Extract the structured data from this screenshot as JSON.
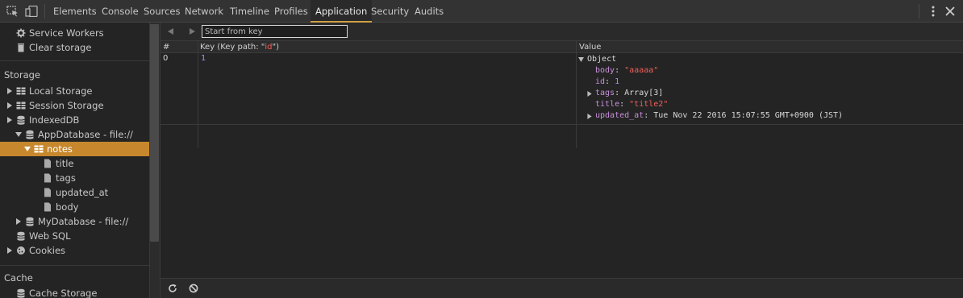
{
  "toolbar": {
    "tabs": [
      {
        "label": "Elements"
      },
      {
        "label": "Console"
      },
      {
        "label": "Sources"
      },
      {
        "label": "Network"
      },
      {
        "label": "Timeline"
      },
      {
        "label": "Profiles"
      },
      {
        "label": "Application",
        "active": true
      },
      {
        "label": "Security"
      },
      {
        "label": "Audits"
      }
    ],
    "icons": [
      "inspect-element-icon",
      "device-mode-icon",
      "more-options-icon",
      "close-icon"
    ]
  },
  "sidebar": {
    "application_items": [
      {
        "label": "Service Workers",
        "icon": "gear-icon"
      },
      {
        "label": "Clear storage",
        "icon": "trash-icon"
      }
    ],
    "storage_header": "Storage",
    "storage_items": [
      {
        "label": "Local Storage",
        "icon": "grid-icon"
      },
      {
        "label": "Session Storage",
        "icon": "grid-icon"
      },
      {
        "label": "IndexedDB",
        "icon": "database-icon"
      },
      {
        "label": "AppDatabase - file://",
        "icon": "database-icon"
      },
      {
        "label": "notes",
        "icon": "grid-icon",
        "selected": true
      },
      {
        "label": "title",
        "icon": "file-icon"
      },
      {
        "label": "tags",
        "icon": "file-icon"
      },
      {
        "label": "updated_at",
        "icon": "file-icon"
      },
      {
        "label": "body",
        "icon": "file-icon"
      },
      {
        "label": "MyDatabase - file://",
        "icon": "database-icon"
      },
      {
        "label": "Web SQL",
        "icon": "database-icon"
      },
      {
        "label": "Cookies",
        "icon": "cookie-icon"
      }
    ],
    "cache_header": "Cache",
    "cache_items": [
      {
        "label": "Cache Storage",
        "icon": "database-icon"
      }
    ]
  },
  "main": {
    "start_key_placeholder": "Start from key",
    "columns": {
      "index": "#",
      "key": "Key (Key path: \"",
      "key_path": "id",
      "key_suffix": "\")",
      "value": "Value"
    },
    "rows": [
      {
        "index": "0",
        "key": "1",
        "value": {
          "root": "Object",
          "body_prop": "body",
          "body_val": "\"aaaaa\"",
          "id_prop": "id",
          "id_val": "1",
          "tags_prop": "tags",
          "tags_val": "Array[3]",
          "title_prop": "title",
          "title_val": "\"title2\"",
          "updated_prop": "updated_at",
          "updated_val": "Tue Nov 22 2016 15:07:55 GMT+0900 (JST)"
        }
      }
    ]
  },
  "colors": {
    "accent": "#c7882d",
    "active_tab_underline": "#d0a046",
    "property": "#c98fdb",
    "string": "#f0605a",
    "number": "#9d8ff5"
  }
}
